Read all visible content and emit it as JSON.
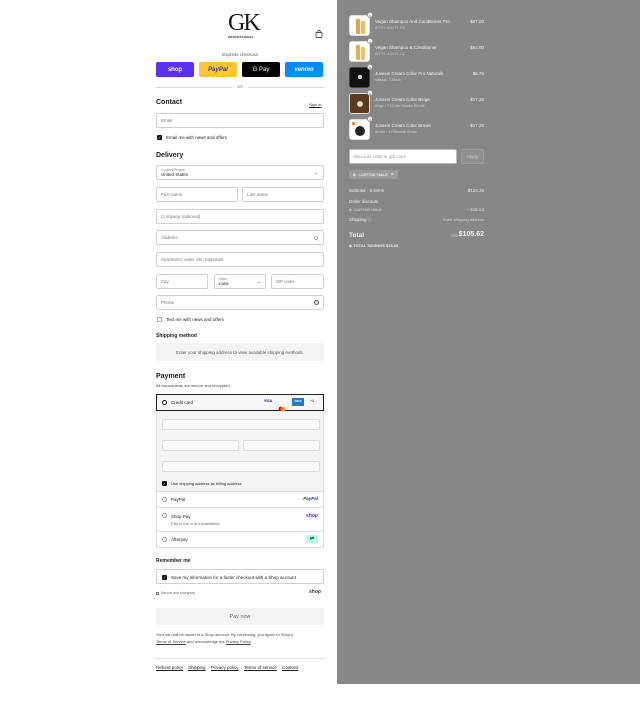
{
  "brand": {
    "logo_text": "GK",
    "logo_sub": "PROFESSIONAL"
  },
  "express": {
    "label": "Express checkout",
    "buttons": [
      {
        "label": "shop",
        "bg": "#5a31f4",
        "fg": "#ffffff"
      },
      {
        "label": "PayPal",
        "bg": "#ffc439",
        "fg": "#253b80"
      },
      {
        "label": "G Pay",
        "bg": "#000000",
        "fg": "#ffffff"
      },
      {
        "label": "venmo",
        "bg": "#008cff",
        "fg": "#ffffff"
      }
    ],
    "or": "OR"
  },
  "contact": {
    "title": "Contact",
    "sign_in": "Sign in",
    "email_placeholder": "Email",
    "news_label": "Email me with news and offers"
  },
  "delivery": {
    "title": "Delivery",
    "country_label": "Country/Region",
    "country_value": "United States",
    "first_name": "First name",
    "last_name": "Last name",
    "company": "Company (optional)",
    "address": "Address",
    "apartment": "Apartment, suite, etc. (optional)",
    "city": "City",
    "state_label": "State",
    "state_value": "Iowa",
    "zip": "ZIP code",
    "phone": "Phone",
    "text_label": "Text me with news and offers"
  },
  "shipping": {
    "title": "Shipping method",
    "notice": "Enter your shipping address to view available shipping methods."
  },
  "payment": {
    "title": "Payment",
    "subtitle": "All transactions are secure and encrypted.",
    "credit_card": "Credit card",
    "card_badges": [
      "VISA",
      "MC",
      "AMEX",
      "+4"
    ],
    "billing_label": "Use shipping address as billing address",
    "methods": [
      {
        "name": "PayPal",
        "logo": "PayPal"
      },
      {
        "name": "Shop Pay",
        "sub": "Pay in full or in installments",
        "logo": "shop"
      },
      {
        "name": "Afterpay",
        "logo": "⇄"
      }
    ]
  },
  "remember": {
    "title": "Remember me",
    "save_label": "Save my information for a faster checkout with a Shop account",
    "secure": "Secure and encrypted",
    "shop_logo": "shop"
  },
  "pay_now": "Pay now",
  "legal": {
    "line1": "Your info will be saved to a Shop account. By continuing, you agree to Shop's",
    "terms": "Terms of Service",
    "and": " and acknowledge the ",
    "privacy": "Privacy Policy",
    "end": "."
  },
  "footer_links": [
    "Refund policy",
    "Shipping",
    "Privacy policy",
    "Terms of service",
    "Cookies"
  ],
  "cart": {
    "items": [
      {
        "name": "Vegan Shampoo And Conditioner Pro",
        "sub": "BOTH / 8.11 FL OZ",
        "price": "$27.00",
        "qty": "1",
        "thumb": "#e9a23b"
      },
      {
        "name": "Vegan Shampoo & Conditioner",
        "sub": "BOTH / 8.11 FL OZ",
        "price": "$54.00",
        "qty": "1",
        "thumb": "#e2b04a"
      },
      {
        "name": "Juvexin Cream Color Pro Naturals",
        "sub": "Natural / 1 Black",
        "price": "$8.75",
        "qty": "1",
        "thumb": "#111111"
      },
      {
        "name": "Juvexin Cream Color Beige",
        "sub": "Beige / 7.13 Ash Golden Blonde",
        "price": "$17.25",
        "qty": "1",
        "thumb": "#5c3a22"
      },
      {
        "name": "Juvexin Cream Color Brown",
        "sub": "Brown / 4.4 Brownie Brown",
        "price": "$17.25",
        "qty": "1",
        "thumb": "#222222"
      }
    ],
    "discount_placeholder": "Discount code or gift card",
    "apply": "Apply",
    "code_chip": "CORTNEYMILE",
    "subtotal_label": "Subtotal · 5 items",
    "subtotal_value": "$124.25",
    "order_discount": "Order discount",
    "discount_code": "CORTNEYMILE",
    "discount_value": "– $18.63",
    "shipping_label": "Shipping",
    "shipping_value": "Enter shipping address",
    "total_label": "Total",
    "currency": "USD",
    "total_value": "$105.62",
    "savings_label": "TOTAL SAVINGS",
    "savings_value": "$18.63"
  }
}
